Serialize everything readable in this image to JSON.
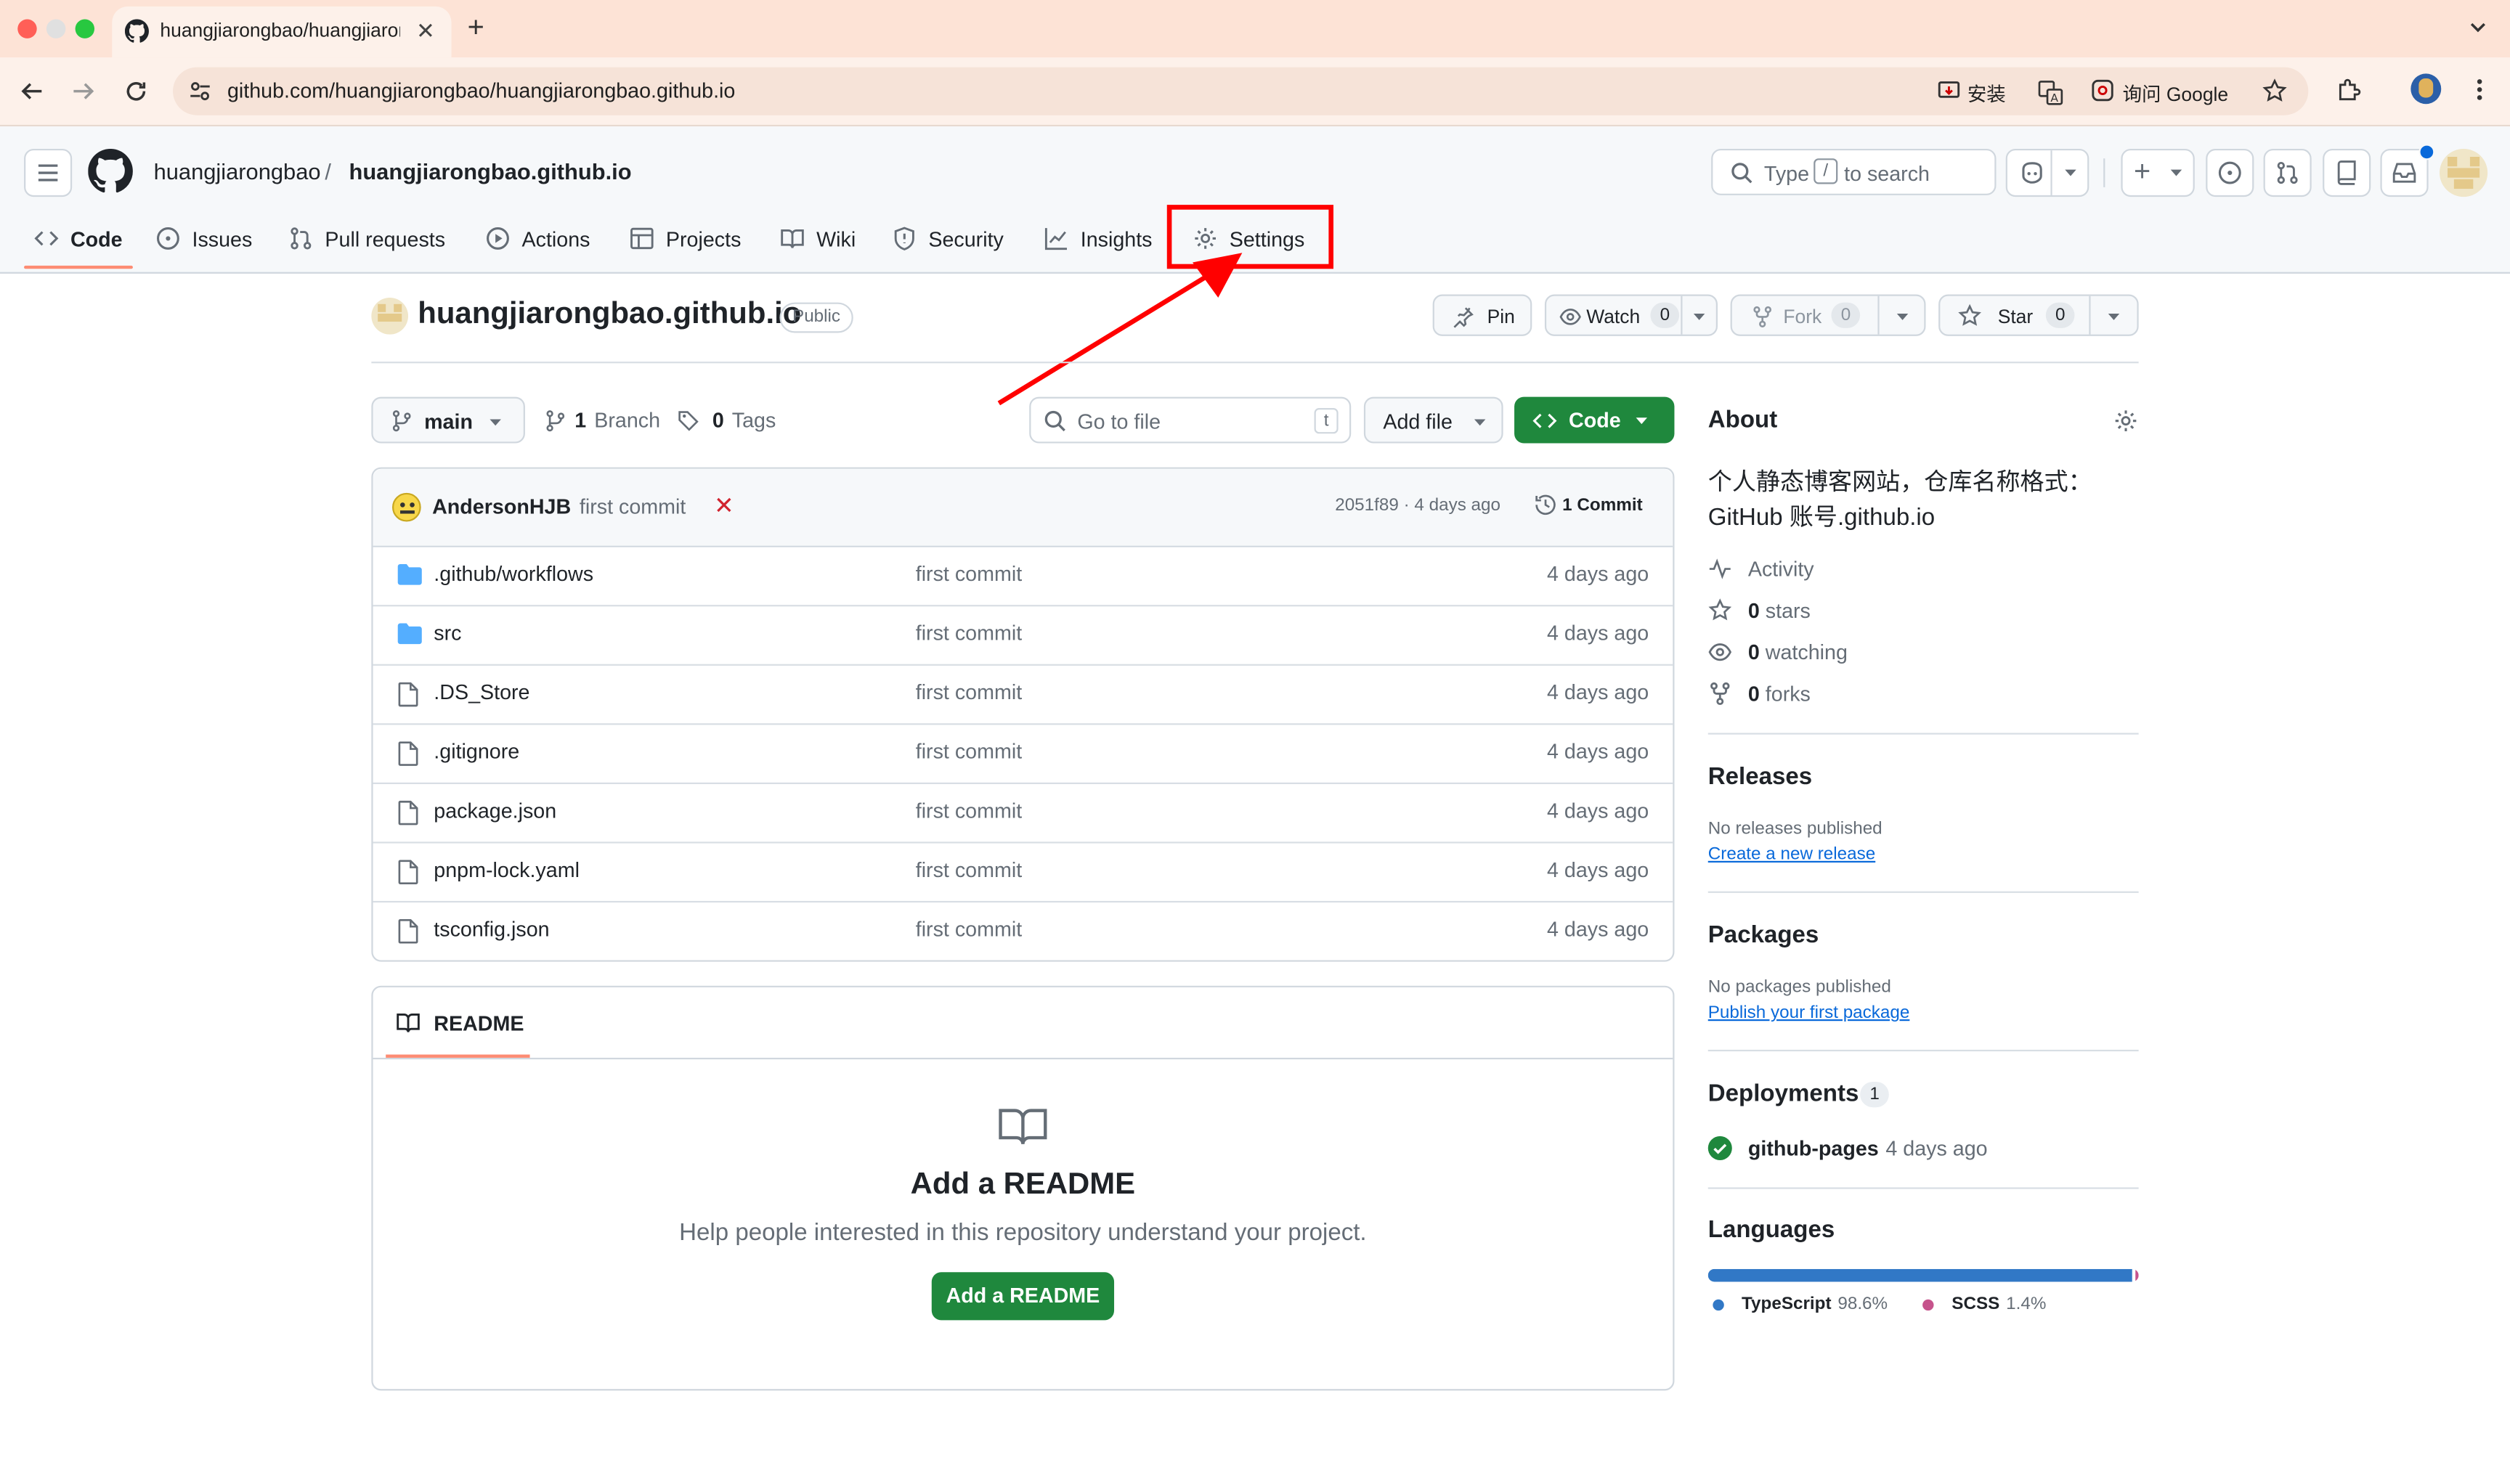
{
  "browser": {
    "tab_title": "huangjiarongbao/huangjiarongbao.github.io",
    "url": "github.com/huangjiarongbao/huangjiarongbao.github.io",
    "install_label": "安装",
    "ask_google_label": "询问 Google"
  },
  "header": {
    "owner": "huangjiarongbao",
    "separator": "/",
    "repo": "huangjiarongbao.github.io",
    "search_prefix": "Type",
    "search_key": "/",
    "search_suffix": "to search"
  },
  "nav": {
    "tabs": [
      {
        "label": "Code",
        "icon": "code-icon",
        "selected": true
      },
      {
        "label": "Issues",
        "icon": "issue-icon"
      },
      {
        "label": "Pull requests",
        "icon": "pull-request-icon"
      },
      {
        "label": "Actions",
        "icon": "play-icon"
      },
      {
        "label": "Projects",
        "icon": "table-icon"
      },
      {
        "label": "Wiki",
        "icon": "book-icon"
      },
      {
        "label": "Security",
        "icon": "shield-icon"
      },
      {
        "label": "Insights",
        "icon": "graph-icon"
      },
      {
        "label": "Settings",
        "icon": "gear-icon",
        "highlighted": true
      }
    ]
  },
  "repo_head": {
    "name": "huangjiarongbao.github.io",
    "visibility": "Public",
    "pin_label": "Pin",
    "watch_label": "Watch",
    "watch_count": "0",
    "fork_label": "Fork",
    "fork_count": "0",
    "star_label": "Star",
    "star_count": "0"
  },
  "branch_bar": {
    "branch": "main",
    "branches_count": "1",
    "branches_label": "Branch",
    "tags_count": "0",
    "tags_label": "Tags",
    "go_to_file": "Go to file",
    "go_to_file_key": "t",
    "add_file": "Add file",
    "code_button": "Code"
  },
  "latest_commit": {
    "author": "AndersonHJB",
    "message": "first commit",
    "hash_time": "2051f89 · 4 days ago",
    "commits_label": "1 Commit"
  },
  "files": [
    {
      "name": ".github/workflows",
      "type": "folder",
      "message": "first commit",
      "date": "4 days ago"
    },
    {
      "name": "src",
      "type": "folder",
      "message": "first commit",
      "date": "4 days ago"
    },
    {
      "name": ".DS_Store",
      "type": "file",
      "message": "first commit",
      "date": "4 days ago"
    },
    {
      "name": ".gitignore",
      "type": "file",
      "message": "first commit",
      "date": "4 days ago"
    },
    {
      "name": "package.json",
      "type": "file",
      "message": "first commit",
      "date": "4 days ago"
    },
    {
      "name": "pnpm-lock.yaml",
      "type": "file",
      "message": "first commit",
      "date": "4 days ago"
    },
    {
      "name": "tsconfig.json",
      "type": "file",
      "message": "first commit",
      "date": "4 days ago"
    }
  ],
  "readme": {
    "tab_label": "README",
    "title": "Add a README",
    "description": "Help people interested in this repository understand your project.",
    "button": "Add a README"
  },
  "about": {
    "heading": "About",
    "description_line1": "个人静态博客网站，仓库名称格式：",
    "description_line2": "GitHub 账号.github.io",
    "activity": "Activity",
    "stars_count": "0",
    "stars_label": "stars",
    "watching_count": "0",
    "watching_label": "watching",
    "forks_count": "0",
    "forks_label": "forks"
  },
  "releases": {
    "heading": "Releases",
    "text": "No releases published",
    "link": "Create a new release"
  },
  "packages": {
    "heading": "Packages",
    "text": "No packages published",
    "link": "Publish your first package"
  },
  "deployments": {
    "heading": "Deployments",
    "count": "1",
    "env": "github-pages",
    "time": "4 days ago"
  },
  "languages": {
    "heading": "Languages",
    "items": [
      {
        "name": "TypeScript",
        "percent": "98.6%",
        "value": 98.6,
        "color": "#3178c6"
      },
      {
        "name": "SCSS",
        "percent": "1.4%",
        "value": 1.4,
        "color": "#c6538c"
      }
    ]
  },
  "colors": {
    "annotation_red": "#ff0000",
    "primary_green": "#1f883d",
    "link_blue": "#0969da",
    "tab_underline": "#fd8c73"
  }
}
